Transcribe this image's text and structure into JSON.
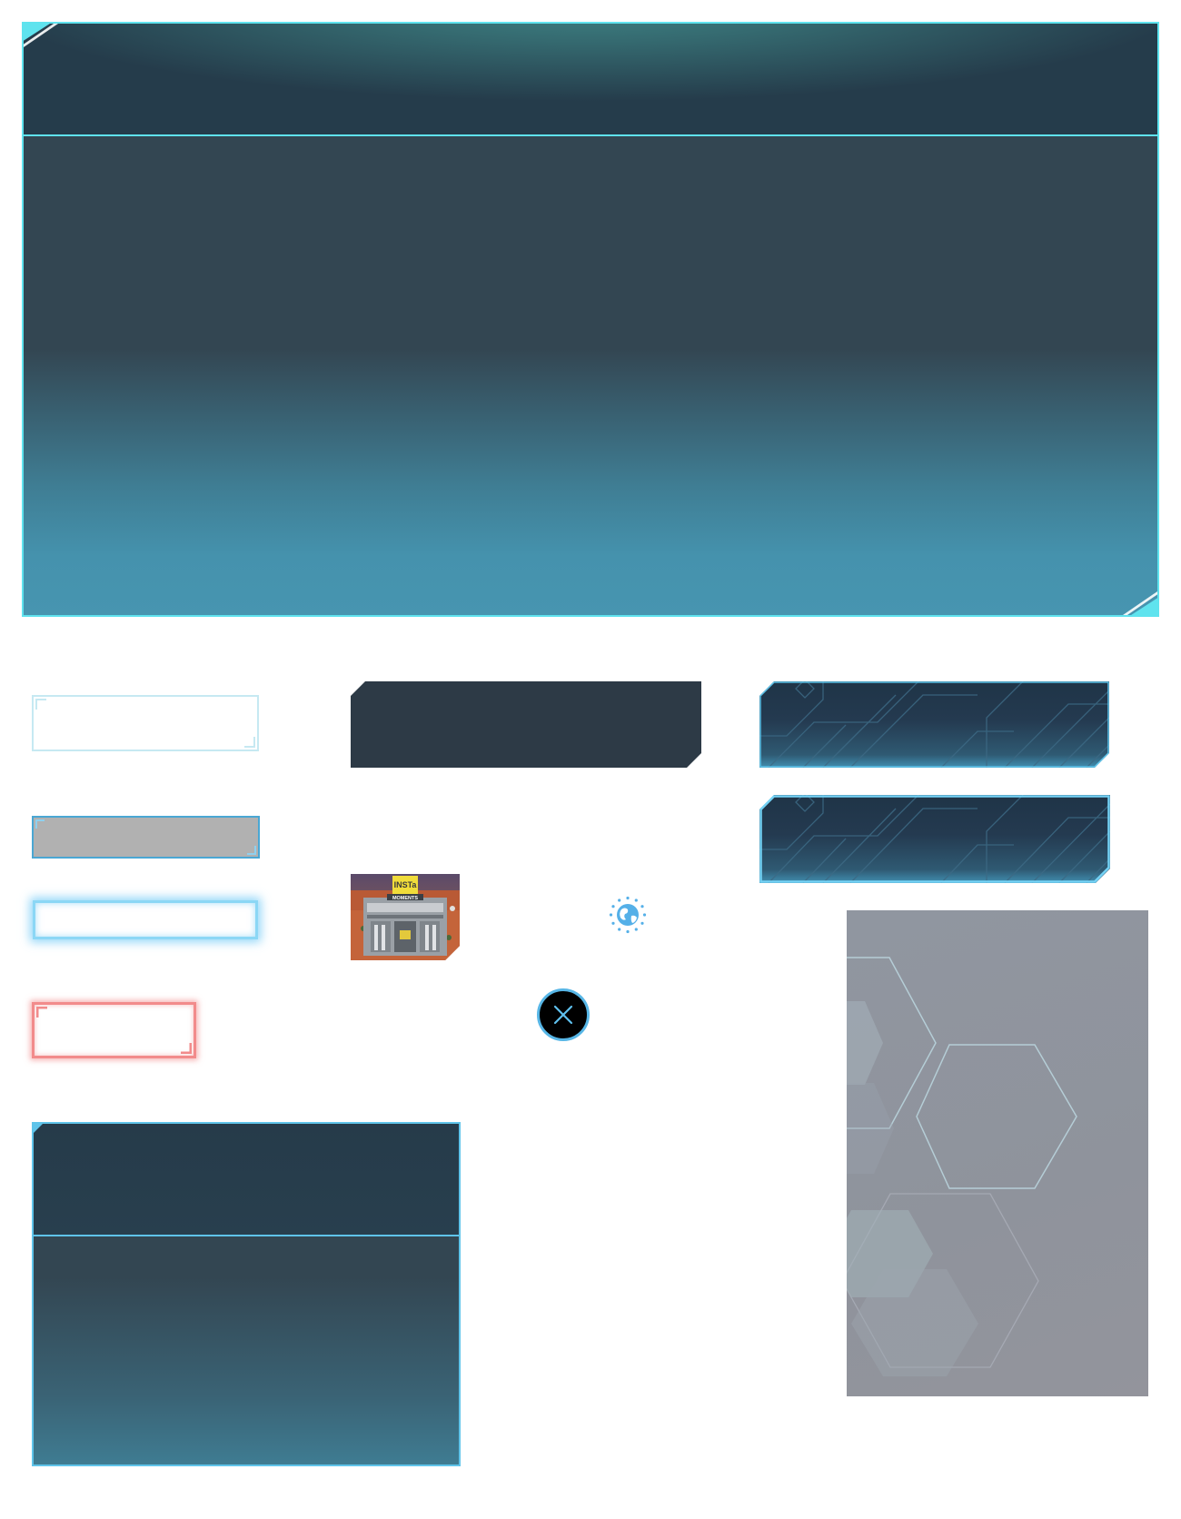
{
  "main_panel": {
    "border_color": "#5fe3ee",
    "header_glow_color": "#3f8687",
    "bottom_color": "#4795b0"
  },
  "frames": {
    "outline_frame_color": "#c6e9f2",
    "grey_frame_fill": "#b1b1b1",
    "glow_blue_color": "#8bd7f5",
    "glow_red_color": "#f28b8b"
  },
  "thumbnail": {
    "sign_text": "MOMENTS",
    "logo_text": "INSTa"
  },
  "icons": {
    "globe": "globe-icon",
    "close": "close-icon"
  },
  "circuit_buttons": {
    "accent": "#5fc4ea"
  },
  "hex_panel": {
    "fill": "#9096a0"
  },
  "bottom_panel": {
    "border_color": "#5fc4ea"
  }
}
